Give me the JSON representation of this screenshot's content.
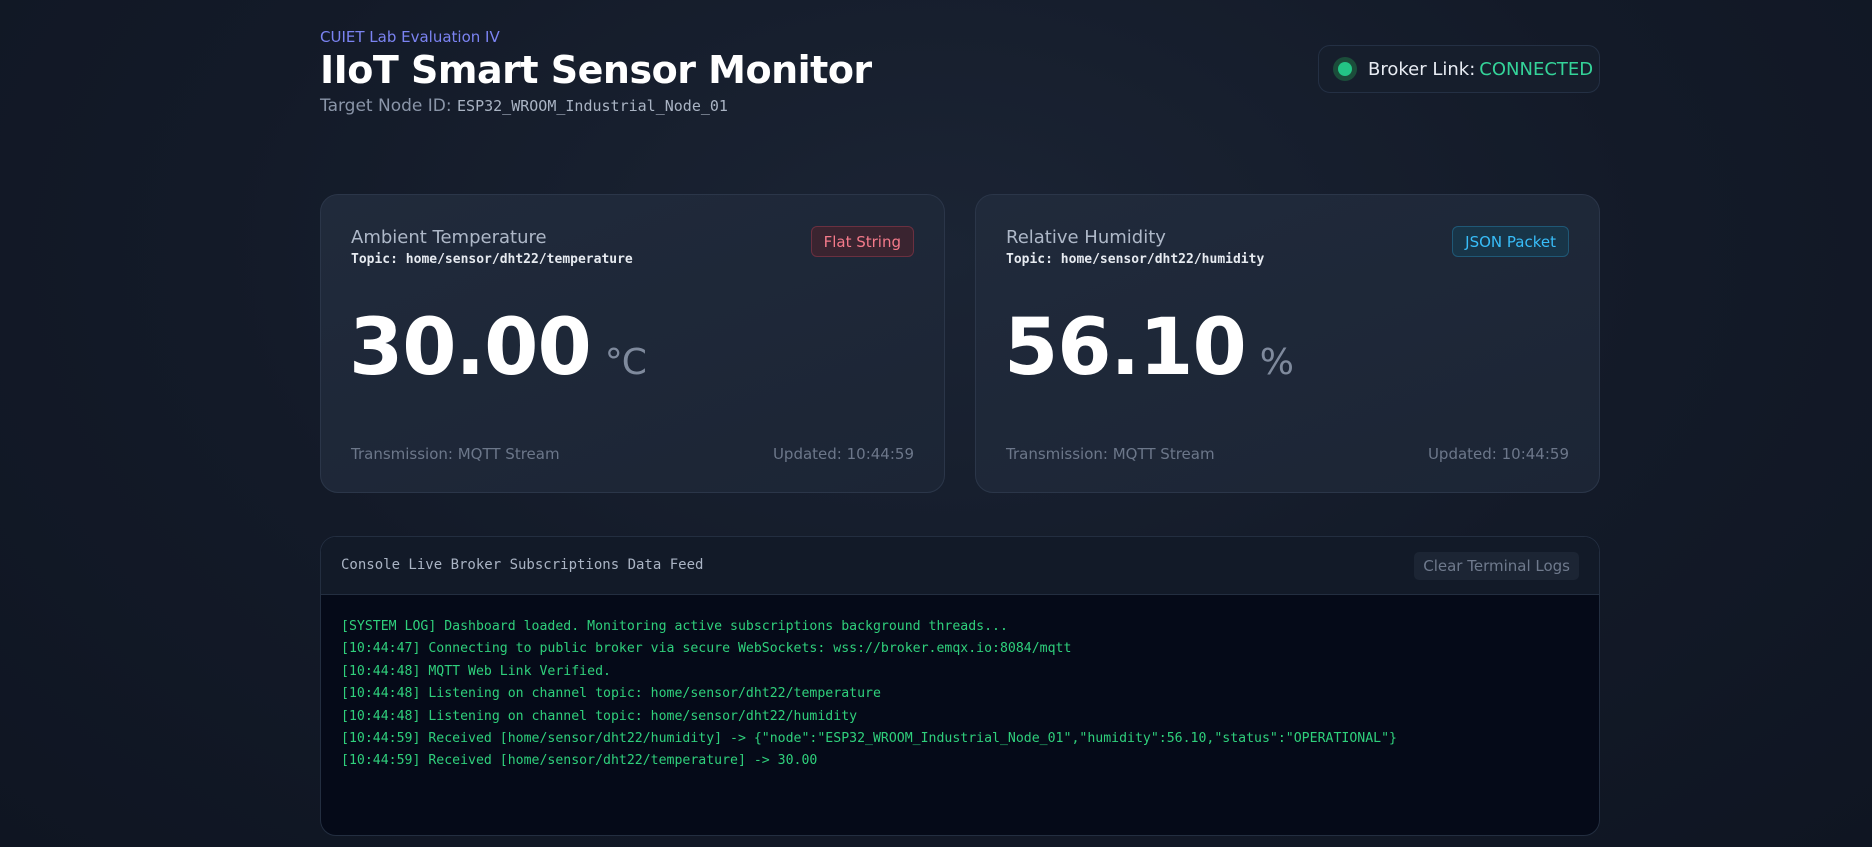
{
  "header": {
    "eyebrow": "CUIET Lab Evaluation IV",
    "title": "IIoT Smart Sensor Monitor",
    "node_label": "Target Node ID:",
    "node_id": "ESP32_WROOM_Industrial_Node_01"
  },
  "broker": {
    "label": "Broker Link:",
    "status": "CONNECTED",
    "status_color": "#34d399"
  },
  "cards": [
    {
      "label": "Ambient Temperature",
      "topic": "Topic: home/sensor/dht22/temperature",
      "badge": "Flat String",
      "value": "30.00",
      "unit": "°C",
      "transmission": "Transmission: MQTT Stream",
      "updated": "Updated: 10:44:59"
    },
    {
      "label": "Relative Humidity",
      "topic": "Topic: home/sensor/dht22/humidity",
      "badge": "JSON Packet",
      "value": "56.10",
      "unit": "%",
      "transmission": "Transmission: MQTT Stream",
      "updated": "Updated: 10:44:59"
    }
  ],
  "console": {
    "title": "Console Live Broker Subscriptions Data Feed",
    "clear_label": "Clear Terminal Logs",
    "lines": [
      "[SYSTEM LOG] Dashboard loaded. Monitoring active subscriptions background threads...",
      "[10:44:47] Connecting to public broker via secure WebSockets: wss://broker.emqx.io:8084/mqtt",
      "[10:44:48] MQTT Web Link Verified.",
      "[10:44:48] Listening on channel topic: home/sensor/dht22/temperature",
      "[10:44:48] Listening on channel topic: home/sensor/dht22/humidity",
      "[10:44:59] Received [home/sensor/dht22/humidity] -> {\"node\":\"ESP32_WROOM_Industrial_Node_01\",\"humidity\":56.10,\"status\":\"OPERATIONAL\"}",
      "[10:44:59] Received [home/sensor/dht22/temperature] -> 30.00"
    ]
  }
}
